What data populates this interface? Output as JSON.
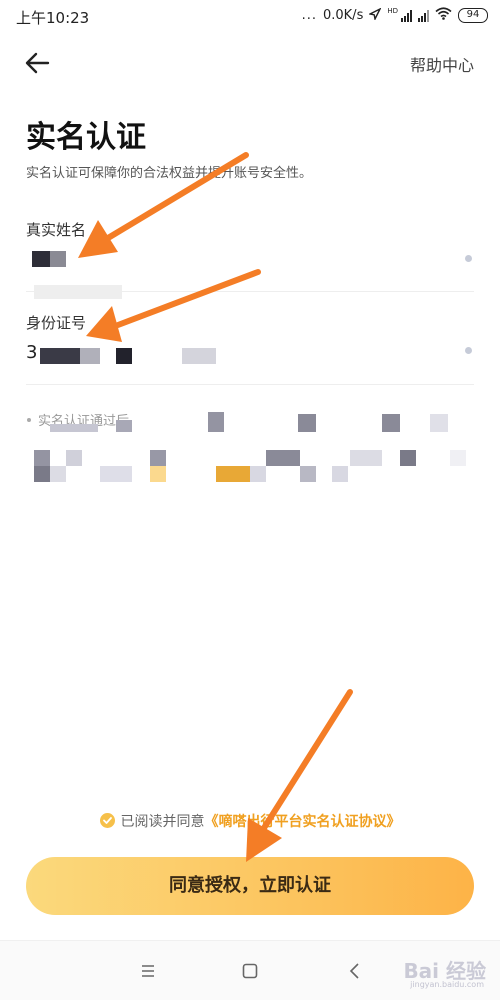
{
  "status_bar": {
    "time": "上午10:23",
    "dots": "...",
    "speed": "0.0K/s",
    "network_badge": "HD",
    "battery": "94",
    "icons": [
      "location-icon",
      "signal-icon",
      "wifi-icon",
      "battery-icon"
    ]
  },
  "header": {
    "back_icon": "arrow-left-icon",
    "help_label": "帮助中心"
  },
  "page": {
    "title": "实名认证",
    "subtitle": "实名认证可保障你的合法权益并提升账号安全性。"
  },
  "form": {
    "name_label": "真实姓名",
    "id_label": "身份证号",
    "id_value_prefix": "3"
  },
  "notice": {
    "text": "实名认证通过后"
  },
  "agreement": {
    "prefix": "已阅读并同意",
    "link": "《嘀嗒出行平台实名认证协议》"
  },
  "primary_button": {
    "label": "同意授权，立即认证"
  },
  "nav_bar": {
    "icons": [
      "menu-icon",
      "home-icon",
      "back-nav-icon"
    ]
  },
  "watermark": {
    "text": "Bai 经验",
    "sub": "jingyan.baidu.com"
  },
  "colors": {
    "accent": "#fdb347",
    "accent_light": "#fbd97c",
    "link": "#f0a020",
    "annotation_arrow": "#f47d26"
  }
}
